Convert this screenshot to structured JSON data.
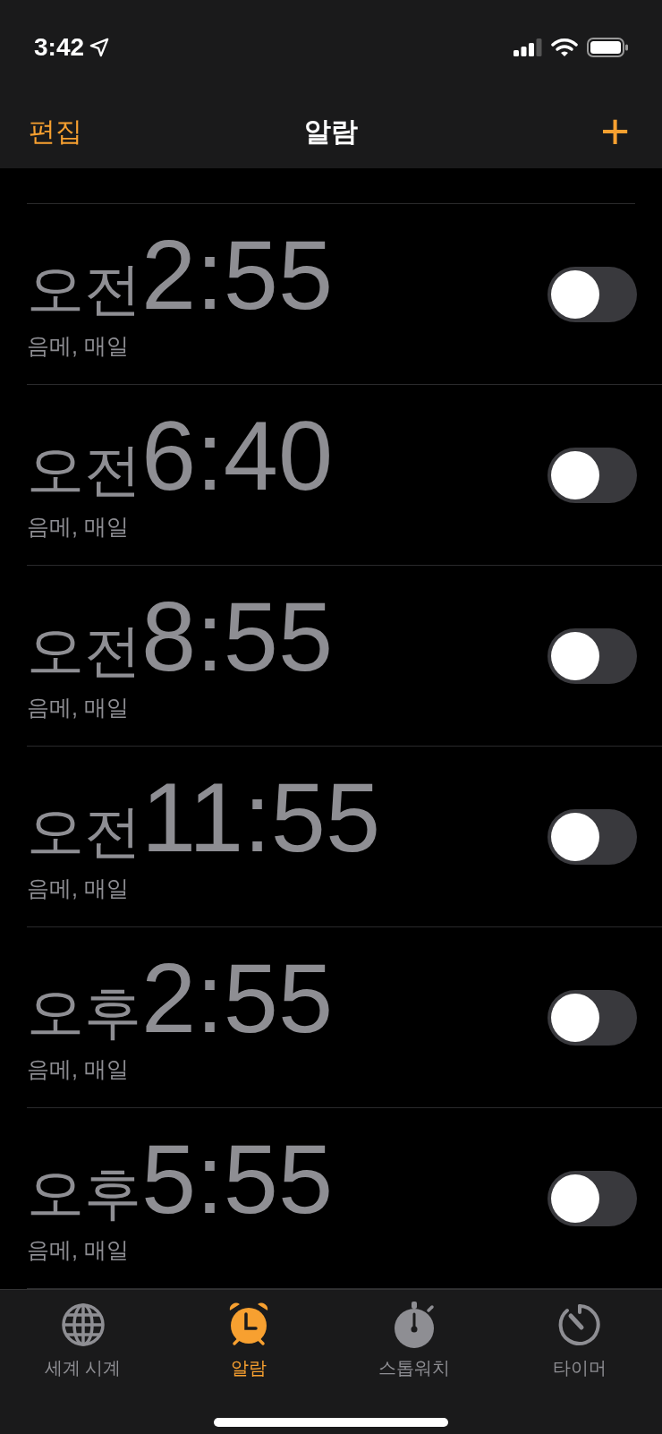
{
  "status_bar": {
    "time": "3:42"
  },
  "nav": {
    "edit": "편집",
    "title": "알람",
    "add": "+"
  },
  "alarms": [
    {
      "period": "오전",
      "time": "2:55",
      "label": "음메, 매일",
      "on": false
    },
    {
      "period": "오전",
      "time": "6:40",
      "label": "음메, 매일",
      "on": false
    },
    {
      "period": "오전",
      "time": "8:55",
      "label": "음메, 매일",
      "on": false
    },
    {
      "period": "오전",
      "time": "11:55",
      "label": "음메, 매일",
      "on": false
    },
    {
      "period": "오후",
      "time": "2:55",
      "label": "음메, 매일",
      "on": false
    },
    {
      "period": "오후",
      "time": "5:55",
      "label": "음메, 매일",
      "on": false
    }
  ],
  "tabs": [
    {
      "kind": "globe",
      "label": "세계 시계",
      "selected": false
    },
    {
      "kind": "alarm",
      "label": "알람",
      "selected": true
    },
    {
      "kind": "stopwatch",
      "label": "스톱워치",
      "selected": false
    },
    {
      "kind": "timer",
      "label": "타이머",
      "selected": false
    }
  ]
}
